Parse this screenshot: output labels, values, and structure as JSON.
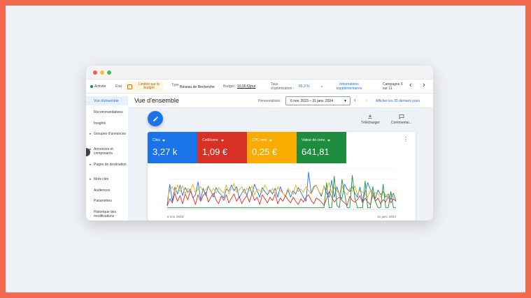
{
  "status_bar": {
    "active": "Activée",
    "etat_label": "État",
    "limit_label": "Limitée par le budget",
    "type_label": "Type",
    "type_value": "Réseau de Recherche",
    "budget_label": "Budget :",
    "budget_value": "10,00 €/jour",
    "taux_label": "Taux d'optimisation :",
    "taux_value": "65,3 %",
    "info_link": "Informations supplémentaires",
    "campaign_counter": "Campagne 6 sur 11"
  },
  "sidebar": {
    "items": [
      {
        "label": "Vue d'ensemble",
        "active": true,
        "expandable": false
      },
      {
        "label": "Recommandations",
        "active": false,
        "expandable": false
      },
      {
        "label": "Insights",
        "active": false,
        "expandable": false
      },
      {
        "label": "Groupes d'annonces",
        "active": false,
        "expandable": true
      },
      {
        "label": "Annonces et composants",
        "active": false,
        "expandable": true
      },
      {
        "label": "Pages de destination",
        "active": false,
        "expandable": true
      },
      {
        "label": "Mots clés",
        "active": false,
        "expandable": true
      },
      {
        "label": "Audiences",
        "active": false,
        "expandable": false
      },
      {
        "label": "Paramètres",
        "active": false,
        "expandable": false
      },
      {
        "label": "Historique des modifications",
        "active": false,
        "expandable": false
      }
    ]
  },
  "header": {
    "title": "Vue d'ensemble",
    "custom_label": "Personnalisée",
    "date_range": "6 nov. 2023 – 31 janv. 2024",
    "last30_link": "Afficher les 30 derniers jours"
  },
  "toolbar": {
    "download_label": "Télécharger",
    "comment_label": "Commentai..."
  },
  "metrics": [
    {
      "label": "Clics",
      "value": "3,27 k",
      "color": "#1a73e8"
    },
    {
      "label": "Coût/conv.",
      "value": "1,09 €",
      "color": "#d93025"
    },
    {
      "label": "CPC moy.",
      "value": "0,25 €",
      "color": "#f9ab00"
    },
    {
      "label": "Valeur de conv.",
      "value": "641,81",
      "color": "#1e8e3e"
    }
  ],
  "chart_data": {
    "type": "line",
    "x_start_label": "6 nov. 2023",
    "x_end_label": "31 janv. 2024",
    "series": [
      {
        "name": "Clics",
        "color": "#1a73e8",
        "values": [
          10,
          62,
          20,
          55,
          38,
          60,
          34,
          54,
          42,
          50,
          28,
          36,
          68,
          24,
          52,
          34,
          58,
          44,
          30,
          54,
          42,
          36,
          28,
          50,
          45,
          60,
          46,
          56,
          28,
          40,
          50,
          34,
          56,
          38,
          62,
          46,
          30,
          54,
          44,
          36,
          48,
          38,
          52,
          30,
          56,
          40,
          32,
          48,
          30,
          46,
          38,
          54,
          42,
          30,
          20,
          92,
          40,
          56,
          60,
          44,
          32,
          58,
          40,
          30,
          72,
          30,
          56,
          34,
          26,
          62,
          50,
          44,
          56,
          40,
          30,
          55,
          20,
          42,
          66,
          50,
          40,
          28,
          48,
          36,
          44,
          30,
          38,
          24,
          40,
          20
        ]
      },
      {
        "name": "Coût/conv.",
        "color": "#d93025",
        "values": [
          8,
          26,
          16,
          40,
          20,
          34,
          14,
          38,
          24,
          46,
          30,
          12,
          36,
          20,
          34,
          42,
          18,
          30,
          40,
          24,
          14,
          32,
          22,
          36,
          16,
          28,
          38,
          20,
          32,
          14,
          26,
          34,
          18,
          40,
          22,
          30,
          12,
          36,
          26,
          16,
          30,
          22,
          38,
          14,
          28,
          20,
          34,
          24,
          16,
          30,
          20,
          12,
          26,
          18,
          30,
          36,
          22,
          14,
          28,
          24,
          18,
          10,
          26,
          44,
          30,
          18,
          26,
          30,
          22,
          16,
          10,
          32,
          22,
          18,
          24,
          34,
          16,
          28,
          18,
          12,
          36,
          20,
          28,
          14,
          24,
          18,
          32,
          16,
          26,
          20
        ]
      },
      {
        "name": "CPC moy.",
        "color": "#f9ab00",
        "values": [
          24,
          48,
          56,
          40,
          60,
          44,
          58,
          38,
          52,
          46,
          62,
          40,
          50,
          56,
          44,
          48,
          58,
          42,
          52,
          40,
          54,
          46,
          40,
          60,
          38,
          52,
          64,
          42,
          48,
          56,
          40,
          52,
          46,
          58,
          36,
          50,
          46,
          42,
          60,
          48,
          42,
          52,
          38,
          56,
          46,
          40,
          34,
          52,
          44,
          38,
          60,
          44,
          50,
          42,
          56,
          46,
          38,
          52,
          60,
          44,
          36,
          56,
          48,
          66,
          40,
          54,
          46,
          38,
          56,
          42,
          36,
          52,
          44,
          58,
          36,
          48,
          42,
          38,
          30,
          46,
          34,
          42,
          38,
          30,
          44,
          36,
          30,
          40,
          30,
          28
        ]
      },
      {
        "name": "Valeur de conv.",
        "color": "#1e8e3e",
        "values": [
          4,
          4,
          4,
          4,
          4,
          4,
          4,
          4,
          4,
          4,
          4,
          4,
          4,
          4,
          4,
          4,
          4,
          4,
          4,
          4,
          4,
          4,
          4,
          4,
          4,
          4,
          4,
          4,
          4,
          4,
          4,
          4,
          4,
          4,
          4,
          4,
          4,
          4,
          4,
          4,
          4,
          4,
          4,
          4,
          4,
          4,
          4,
          4,
          4,
          4,
          4,
          4,
          4,
          4,
          4,
          4,
          4,
          4,
          4,
          4,
          4,
          4,
          66,
          4,
          4,
          82,
          10,
          4,
          74,
          40,
          4,
          4,
          84,
          28,
          4,
          4,
          4,
          70,
          4,
          4,
          56,
          20,
          4,
          4,
          62,
          4,
          4,
          44,
          4,
          4
        ]
      }
    ],
    "grid": true,
    "ylim": [
      0,
      100
    ]
  }
}
